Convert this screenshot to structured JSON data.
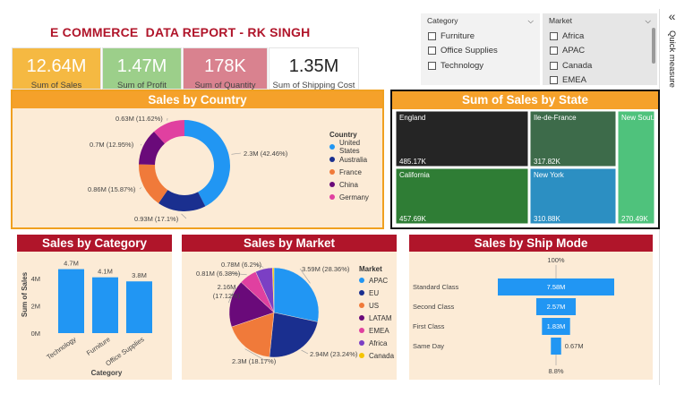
{
  "title": "E COMMERCE  DATA REPORT - RK SINGH",
  "kpis": [
    {
      "value": "12.64M",
      "label": "Sum of Sales",
      "color": "#f5b942"
    },
    {
      "value": "1.47M",
      "label": "Sum of Profit",
      "color": "#9ccf8a"
    },
    {
      "value": "178K",
      "label": "Sum of Quantity",
      "color": "#d9828f"
    },
    {
      "value": "1.35M",
      "label": "Sum of Shipping Cost",
      "color": "#ffffff"
    }
  ],
  "slicers": {
    "category": {
      "title": "Category",
      "options": [
        "Furniture",
        "Office Supplies",
        "Technology"
      ]
    },
    "market": {
      "title": "Market",
      "options": [
        "Africa",
        "APAC",
        "Canada",
        "EMEA"
      ]
    }
  },
  "side_panel": {
    "label": "Quick measure",
    "collapse_glyph": "«"
  },
  "icons": {
    "chevron": "chevron-down-icon",
    "collapse": "collapse-icon"
  },
  "charts": {
    "country": {
      "title": "Sales by Country",
      "legend_title": "Country",
      "type": "donut",
      "labels": [
        "United States",
        "Australia",
        "France",
        "China",
        "Germany"
      ],
      "values": [
        2.3,
        0.93,
        0.86,
        0.7,
        0.63
      ],
      "data_labels": [
        "2.3M (42.46%)",
        "0.93M (17.1%)",
        "0.86M (15.87%)",
        "0.7M (12.95%)",
        "0.63M (11.62%)"
      ],
      "colors": [
        "#2196f3",
        "#1a2f8f",
        "#f07a3a",
        "#6a0a7a",
        "#e040a0"
      ]
    },
    "state": {
      "title": "Sum of Sales by State",
      "type": "treemap",
      "labels": [
        "England",
        "Ile-de-France",
        "New Sout...",
        "California",
        "New York"
      ],
      "values": [
        "485.17K",
        "317.82K",
        "270.49K",
        "457.69K",
        "310.88K"
      ],
      "colors": [
        "#252525",
        "#3d6b4a",
        "#4fc27c",
        "#2f7d35",
        "#2c8fc2"
      ]
    },
    "category": {
      "title": "Sales by Category",
      "type": "bar",
      "categories": [
        "Technology",
        "Furniture",
        "Office Supplies"
      ],
      "values": [
        4.7,
        4.1,
        3.8
      ],
      "value_labels": [
        "4.7M",
        "4.1M",
        "3.8M"
      ],
      "ylabel": "Sum of Sales",
      "xlabel": "Category",
      "yticks": [
        "0M",
        "2M",
        "4M"
      ],
      "ylim": [
        0,
        5
      ],
      "color": "#2196f3"
    },
    "market": {
      "title": "Sales by Market",
      "legend_title": "Market",
      "type": "pie",
      "labels": [
        "APAC",
        "EU",
        "US",
        "LATAM",
        "EMEA",
        "Africa",
        "Canada"
      ],
      "values": [
        3.59,
        2.94,
        2.3,
        2.16,
        0.81,
        0.78,
        0.07
      ],
      "data_labels": [
        "3.59M (28.36%)",
        "2.94M (23.24%)",
        "2.3M (18.17%)",
        "2.16M (17.12%)",
        "0.81M (6.38%)",
        "0.78M (6.2%)",
        ""
      ],
      "colors": [
        "#2196f3",
        "#1a2f8f",
        "#f07a3a",
        "#6a0a7a",
        "#e040a0",
        "#7b3fc4",
        "#f5c400"
      ]
    },
    "shipmode": {
      "title": "Sales by Ship Mode",
      "type": "funnel",
      "top_label": "100%",
      "bottom_label": "8.8%",
      "categories": [
        "Standard Class",
        "Second Class",
        "First Class",
        "Same Day"
      ],
      "values": [
        7.58,
        2.57,
        1.83,
        0.67
      ],
      "value_labels": [
        "7.58M",
        "2.57M",
        "1.83M",
        "0.67M"
      ],
      "color": "#2196f3"
    }
  }
}
